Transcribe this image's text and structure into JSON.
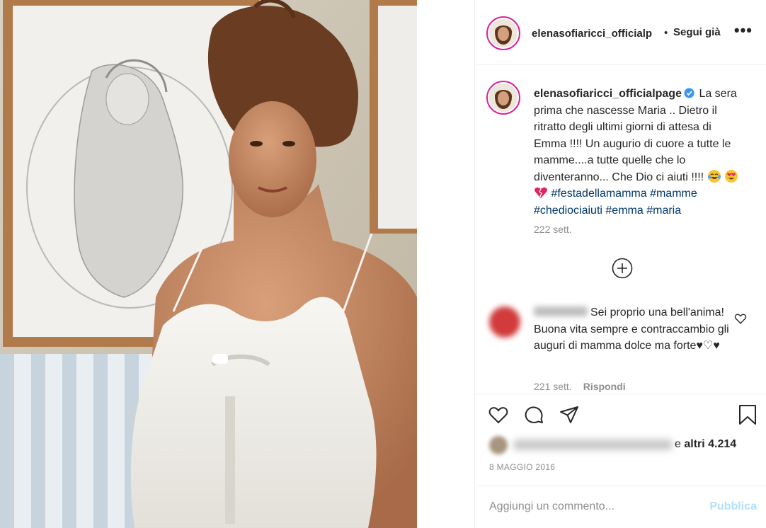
{
  "header": {
    "username": "elenasofiaricci_officialp",
    "separator": "•",
    "follow_label": "Segui già",
    "more": "•••"
  },
  "caption": {
    "username": "elenasofiaricci_officialpage",
    "text": "La sera prima che nascesse Maria .. Dietro il ritratto degli ultimi giorni di attesa di Emma !!!! Un augurio di cuore a tutte le mamme....a tutte quelle che lo diventeranno... Che Dio ci aiuti !!!!",
    "hashtags": [
      "#festadellamamma",
      "#mamme",
      "#chediociaiuti",
      "#emma",
      "#maria"
    ],
    "time": "222 sett."
  },
  "comment": {
    "text": "Sei proprio una bell'anima! Buona vita sempre e contraccambio gli auguri di mamma dolce ma forte♥♡♥",
    "time": "221 sett.",
    "reply_label": "Rispondi"
  },
  "likes": {
    "prefix": "e",
    "others": "altri 4.214"
  },
  "date": "8 MAGGIO 2016",
  "add_comment": {
    "placeholder": "Aggiungi un commento...",
    "publish_label": "Pubblica"
  },
  "icons": {
    "verified": "verified-badge-icon",
    "like": "heart-icon",
    "comment": "comment-icon",
    "share": "paper-plane-icon",
    "save": "bookmark-icon",
    "load_more": "plus-circle-icon"
  },
  "colors": {
    "link": "#00376b",
    "verified": "#3897f0",
    "publish_disabled": "#b2dffc",
    "muted": "#8e8e8e"
  }
}
